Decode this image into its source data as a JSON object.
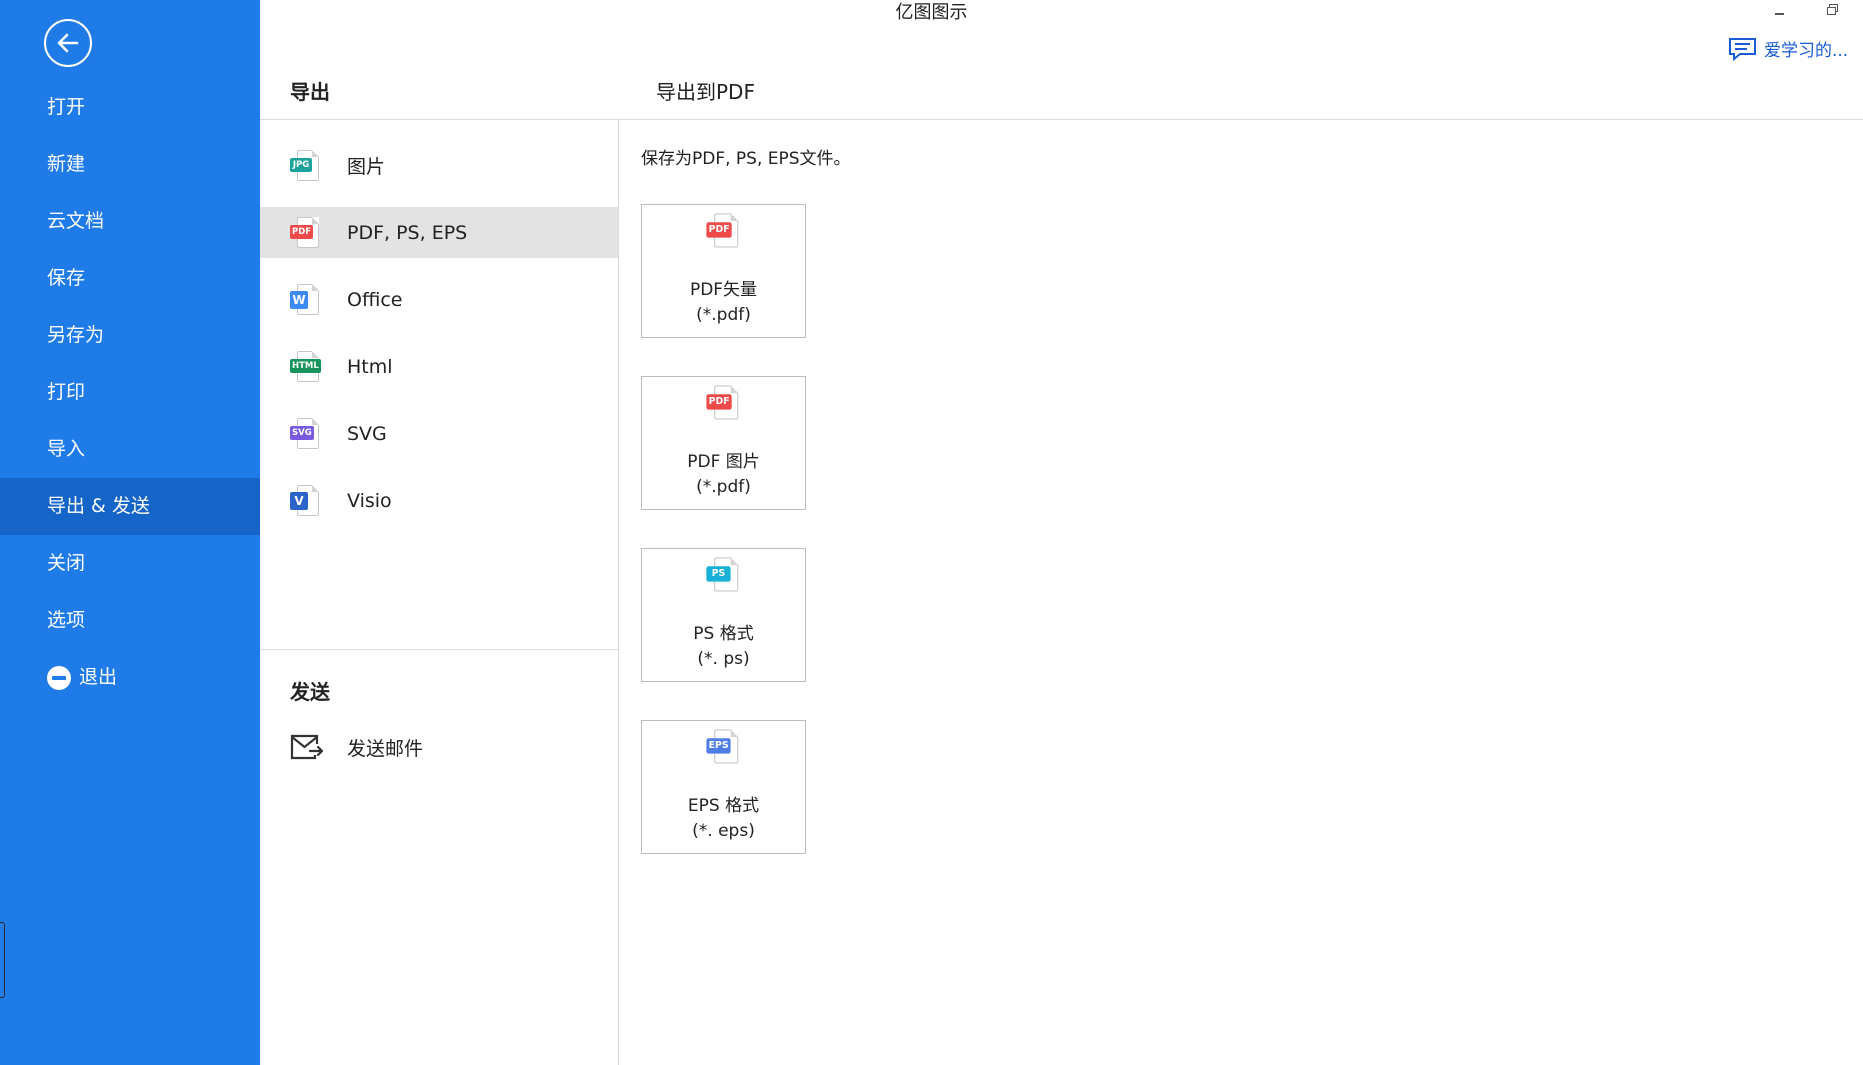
{
  "app": {
    "title": "亿图图示",
    "feedback": "爱学习的..."
  },
  "sidebar": {
    "items": [
      {
        "label": "打开",
        "active": false
      },
      {
        "label": "新建",
        "active": false
      },
      {
        "label": "云文档",
        "active": false
      },
      {
        "label": "保存",
        "active": false
      },
      {
        "label": "另存为",
        "active": false
      },
      {
        "label": "打印",
        "active": false
      },
      {
        "label": "导入",
        "active": false
      },
      {
        "label": "导出 & 发送",
        "active": true
      },
      {
        "label": "关闭",
        "active": false
      },
      {
        "label": "选项",
        "active": false
      },
      {
        "label": "退出",
        "active": false,
        "icon": "exit-icon"
      }
    ]
  },
  "export": {
    "heading": "导出",
    "formats": [
      {
        "label": "图片",
        "tag": "JPG",
        "color": "#1ba39c",
        "icon": "jpg-file-icon"
      },
      {
        "label": "PDF, PS, EPS",
        "tag": "PDF",
        "color": "#ef4a4a",
        "icon": "pdf-file-icon",
        "active": true
      },
      {
        "label": "Office",
        "tag": "W",
        "color": "#3d8af7",
        "icon": "word-file-icon"
      },
      {
        "label": "Html",
        "tag": "HTML",
        "color": "#17955c",
        "icon": "html-file-icon"
      },
      {
        "label": "SVG",
        "tag": "SVG",
        "color": "#7a5be0",
        "icon": "svg-file-icon"
      },
      {
        "label": "Visio",
        "tag": "V",
        "color": "#2c65c9",
        "icon": "visio-file-icon"
      }
    ]
  },
  "send": {
    "heading": "发送",
    "mail_label": "发送邮件"
  },
  "panel": {
    "title": "导出到PDF",
    "description": "保存为PDF, PS, EPS文件。",
    "options": [
      {
        "name": "PDF矢量",
        "ext": "(*.pdf)",
        "tag": "PDF",
        "color": "#ef4a4a",
        "icon": "pdf-file-icon"
      },
      {
        "name": "PDF 图片",
        "ext": "(*.pdf)",
        "tag": "PDF",
        "color": "#ef4a4a",
        "icon": "pdf-file-icon"
      },
      {
        "name": "PS 格式",
        "ext": "(*. ps)",
        "tag": "PS",
        "color": "#17b0d6",
        "icon": "ps-file-icon"
      },
      {
        "name": "EPS 格式",
        "ext": "(*. eps)",
        "tag": "EPS",
        "color": "#4f7fe6",
        "icon": "eps-file-icon"
      }
    ]
  }
}
